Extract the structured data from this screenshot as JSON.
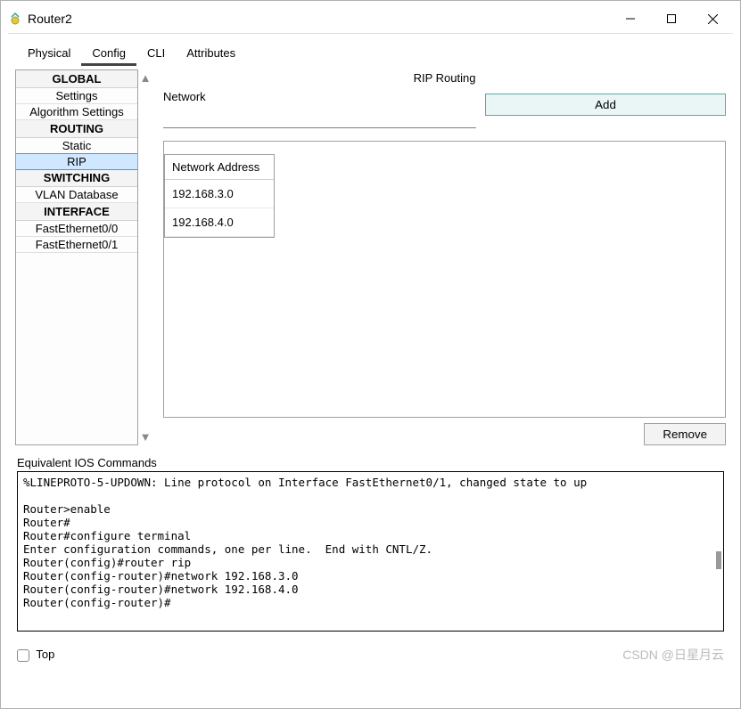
{
  "window": {
    "title": "Router2"
  },
  "tabs": [
    {
      "label": "Physical"
    },
    {
      "label": "Config"
    },
    {
      "label": "CLI"
    },
    {
      "label": "Attributes"
    }
  ],
  "sidebar": {
    "sections": [
      {
        "header": "GLOBAL",
        "items": [
          {
            "label": "Settings"
          },
          {
            "label": "Algorithm Settings"
          }
        ]
      },
      {
        "header": "ROUTING",
        "items": [
          {
            "label": "Static"
          },
          {
            "label": "RIP",
            "selected": true
          }
        ]
      },
      {
        "header": "SWITCHING",
        "items": [
          {
            "label": "VLAN Database"
          }
        ]
      },
      {
        "header": "INTERFACE",
        "items": [
          {
            "label": "FastEthernet0/0"
          },
          {
            "label": "FastEthernet0/1"
          }
        ]
      }
    ]
  },
  "panel": {
    "title": "RIP Routing",
    "network_label": "Network",
    "network_value": "",
    "add_button": "Add",
    "table_header": "Network Address",
    "entries": [
      "192.168.3.0",
      "192.168.4.0"
    ],
    "remove_button": "Remove"
  },
  "console": {
    "label": "Equivalent IOS Commands",
    "lines": [
      "%LINEPROTO-5-UPDOWN: Line protocol on Interface FastEthernet0/1, changed state to up",
      "",
      "Router>enable",
      "Router#",
      "Router#configure terminal",
      "Enter configuration commands, one per line.  End with CNTL/Z.",
      "Router(config)#router rip",
      "Router(config-router)#network 192.168.3.0",
      "Router(config-router)#network 192.168.4.0",
      "Router(config-router)#"
    ]
  },
  "footer": {
    "top_label": "Top",
    "watermark": "CSDN @日星月云"
  }
}
